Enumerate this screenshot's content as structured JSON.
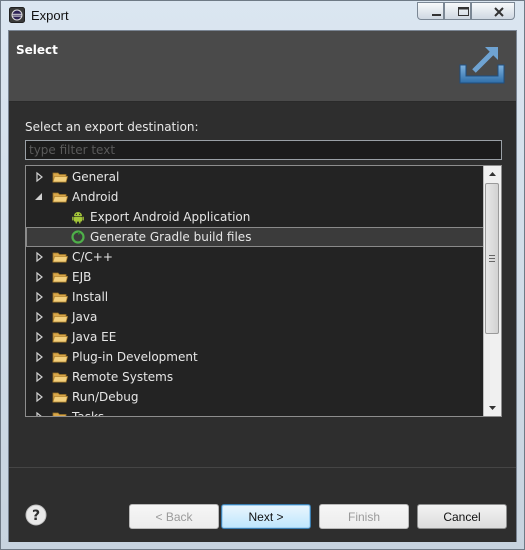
{
  "window": {
    "title": "Export"
  },
  "page": {
    "section_title": "Select",
    "destination_label": "Select an export destination:"
  },
  "filter": {
    "placeholder": "type filter text",
    "value": ""
  },
  "tree": {
    "items": [
      {
        "label": "General",
        "level": 0,
        "expanded": false,
        "icon": "folder-icon"
      },
      {
        "label": "Android",
        "level": 0,
        "expanded": true,
        "icon": "folder-icon"
      },
      {
        "label": "Export Android Application",
        "level": 1,
        "icon": "android-icon"
      },
      {
        "label": "Generate Gradle build files",
        "level": 1,
        "icon": "gradle-icon",
        "selected": true
      },
      {
        "label": "C/C++",
        "level": 0,
        "expanded": false,
        "icon": "folder-icon"
      },
      {
        "label": "EJB",
        "level": 0,
        "expanded": false,
        "icon": "folder-icon"
      },
      {
        "label": "Install",
        "level": 0,
        "expanded": false,
        "icon": "folder-icon"
      },
      {
        "label": "Java",
        "level": 0,
        "expanded": false,
        "icon": "folder-icon"
      },
      {
        "label": "Java EE",
        "level": 0,
        "expanded": false,
        "icon": "folder-icon"
      },
      {
        "label": "Plug-in Development",
        "level": 0,
        "expanded": false,
        "icon": "folder-icon"
      },
      {
        "label": "Remote Systems",
        "level": 0,
        "expanded": false,
        "icon": "folder-icon"
      },
      {
        "label": "Run/Debug",
        "level": 0,
        "expanded": false,
        "icon": "folder-icon"
      },
      {
        "label": "Tasks",
        "level": 0,
        "expanded": false,
        "icon": "folder-icon"
      }
    ]
  },
  "buttons": {
    "back": "< Back",
    "next": "Next >",
    "finish": "Finish",
    "cancel": "Cancel"
  },
  "colors": {
    "dialog_bg": "#2e2e2e",
    "header_bg": "#4a4a4a",
    "tree_bg": "#232323",
    "accent": "#3c7fb1"
  }
}
